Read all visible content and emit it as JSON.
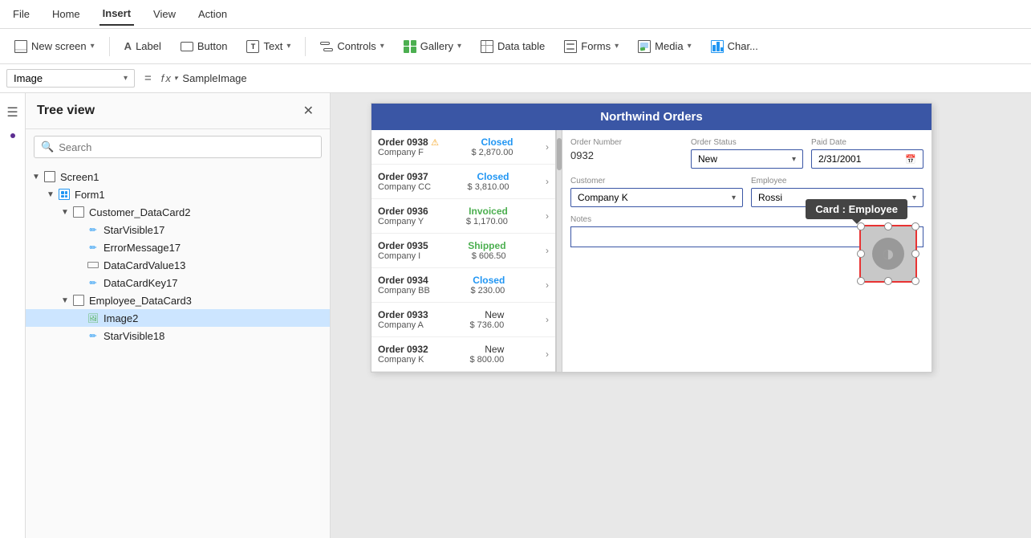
{
  "menu": {
    "items": [
      {
        "label": "File",
        "active": false
      },
      {
        "label": "Home",
        "active": false
      },
      {
        "label": "Insert",
        "active": true
      },
      {
        "label": "View",
        "active": false
      },
      {
        "label": "Action",
        "active": false
      }
    ]
  },
  "toolbar": {
    "buttons": [
      {
        "id": "new-screen",
        "label": "New screen",
        "icon": "screen-icon",
        "hasChevron": true
      },
      {
        "id": "label",
        "label": "Label",
        "icon": "label-icon",
        "hasChevron": false
      },
      {
        "id": "button",
        "label": "Button",
        "icon": "button-icon",
        "hasChevron": false
      },
      {
        "id": "text",
        "label": "Text",
        "icon": "text-icon",
        "hasChevron": true
      },
      {
        "id": "controls",
        "label": "Controls",
        "icon": "controls-icon",
        "hasChevron": true
      },
      {
        "id": "gallery",
        "label": "Gallery",
        "icon": "gallery-icon",
        "hasChevron": true
      },
      {
        "id": "data-table",
        "label": "Data table",
        "icon": "datatable-icon",
        "hasChevron": false
      },
      {
        "id": "forms",
        "label": "Forms",
        "icon": "forms-icon",
        "hasChevron": true
      },
      {
        "id": "media",
        "label": "Media",
        "icon": "media-icon",
        "hasChevron": true
      },
      {
        "id": "charts",
        "label": "Char...",
        "icon": "chart-icon",
        "hasChevron": false
      }
    ]
  },
  "formula_bar": {
    "dropdown_value": "Image",
    "fx_label": "fx",
    "formula_value": "SampleImage"
  },
  "tree_view": {
    "title": "Tree view",
    "search_placeholder": "Search",
    "items": [
      {
        "id": "screen1",
        "label": "Screen1",
        "level": 0,
        "type": "screen",
        "expanded": true
      },
      {
        "id": "form1",
        "label": "Form1",
        "level": 1,
        "type": "form",
        "expanded": true
      },
      {
        "id": "customer-datacard2",
        "label": "Customer_DataCard2",
        "level": 2,
        "type": "datacard",
        "expanded": true
      },
      {
        "id": "starvisible17",
        "label": "StarVisible17",
        "level": 3,
        "type": "edit"
      },
      {
        "id": "errormessage17",
        "label": "ErrorMessage17",
        "level": 3,
        "type": "edit"
      },
      {
        "id": "datacardvalue13",
        "label": "DataCardValue13",
        "level": 3,
        "type": "textinput"
      },
      {
        "id": "datacardkey17",
        "label": "DataCardKey17",
        "level": 3,
        "type": "edit"
      },
      {
        "id": "employee-datacard3",
        "label": "Employee_DataCard3",
        "level": 2,
        "type": "datacard",
        "expanded": true
      },
      {
        "id": "image2",
        "label": "Image2",
        "level": 3,
        "type": "image",
        "selected": true
      },
      {
        "id": "starvisible18",
        "label": "StarVisible18",
        "level": 3,
        "type": "edit"
      }
    ]
  },
  "canvas": {
    "title": "Northwind Orders",
    "orders": [
      {
        "num": "Order 0938",
        "warning": true,
        "company": "Company F",
        "status": "Closed",
        "amount": "$ 2,870.00"
      },
      {
        "num": "Order 0937",
        "warning": false,
        "company": "Company CC",
        "status": "Closed",
        "amount": "$ 3,810.00"
      },
      {
        "num": "Order 0936",
        "warning": false,
        "company": "Company Y",
        "status": "Invoiced",
        "amount": "$ 1,170.00"
      },
      {
        "num": "Order 0935",
        "warning": false,
        "company": "Company I",
        "status": "Shipped",
        "amount": "$ 606.50"
      },
      {
        "num": "Order 0934",
        "warning": false,
        "company": "Company BB",
        "status": "Closed",
        "amount": "$ 230.00"
      },
      {
        "num": "Order 0933",
        "warning": false,
        "company": "Company A",
        "status": "New",
        "amount": "$ 736.00"
      },
      {
        "num": "Order 0932",
        "warning": false,
        "company": "Company K",
        "status": "New",
        "amount": "$ 800.00"
      }
    ],
    "detail": {
      "order_number_label": "Order Number",
      "order_number_value": "0932",
      "order_status_label": "Order Status",
      "order_status_value": "New",
      "paid_date_label": "Paid Date",
      "paid_date_value": "2/31/2001",
      "customer_label": "Customer",
      "customer_value": "Company K",
      "employee_label": "Employee",
      "employee_value": "Rossi",
      "notes_label": "Notes",
      "notes_value": ""
    },
    "tooltip": "Card : Employee"
  }
}
